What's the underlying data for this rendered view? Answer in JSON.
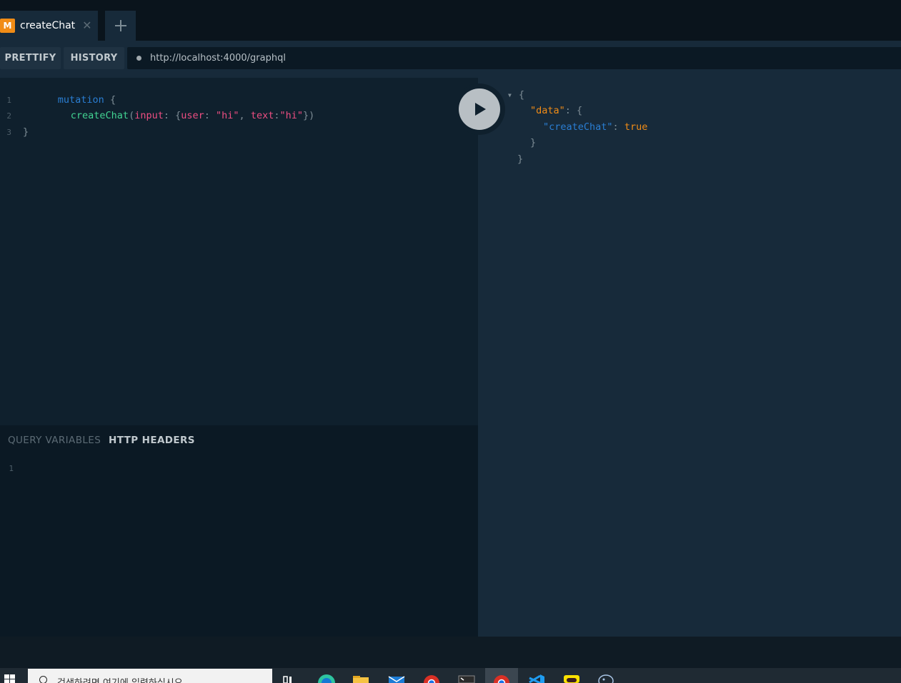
{
  "tabs": [
    {
      "badge": "M",
      "title": "createChat",
      "close": "✕"
    }
  ],
  "toolbar": {
    "prettify_label": "PRETTIFY",
    "history_label": "HISTORY",
    "endpoint_url": "http://localhost:4000/graphql"
  },
  "query_editor": {
    "line_numbers": [
      "1",
      "2",
      "3"
    ],
    "line1": {
      "keyword": "mutation",
      "brace": " {"
    },
    "line2": {
      "field": "createChat",
      "open": "(",
      "arg": "input",
      "colon1": ": ",
      "brace_open": "{",
      "key_user": "user",
      "colon2": ": ",
      "val_user": "\"hi\"",
      "comma": ", ",
      "key_text": "text",
      "colon3": ":",
      "val_text": "\"hi\"",
      "close": "})"
    },
    "line3": {
      "brace": "}"
    }
  },
  "variables_pane": {
    "tab_query_variables": "QUERY VARIABLES",
    "tab_http_headers": "HTTP HEADERS",
    "line_number": "1"
  },
  "result": {
    "open_brace": "{",
    "data_key": "\"data\"",
    "data_sep": ": {",
    "create_chat_key": "\"createChat\"",
    "create_chat_sep": ": ",
    "create_chat_value": "true",
    "inner_close": "}",
    "outer_close": "}"
  },
  "taskbar": {
    "search_placeholder": "검색하려면 여기에 입력하십시오."
  },
  "colors": {
    "badge": "#f18c16",
    "keyword": "#2a7ed3",
    "field": "#42d392",
    "argument": "#ee4e82",
    "result_key": "#f18c16",
    "background": "#0f202d",
    "result_background": "#172a3a"
  },
  "icons": {
    "tab_add": "plus-icon",
    "execute": "play-icon",
    "start": "windows-logo-icon",
    "search": "search-icon"
  }
}
